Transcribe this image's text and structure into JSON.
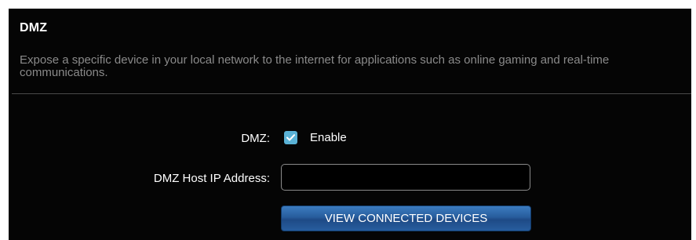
{
  "section": {
    "title": "DMZ",
    "description": "Expose a specific device in your local network to the internet for applications such as online gaming and real-time communications."
  },
  "dmz": {
    "label": "DMZ:",
    "checkbox_checked": true,
    "enable_label": "Enable",
    "accent_color": "#5ab2d6"
  },
  "host_ip": {
    "label": "DMZ Host IP Address:",
    "value": "",
    "placeholder": ""
  },
  "button": {
    "view_devices_label": "VIEW CONNECTED DEVICES",
    "color": "#275c9c"
  },
  "icons": {
    "checkbox": "checkmark-icon"
  }
}
